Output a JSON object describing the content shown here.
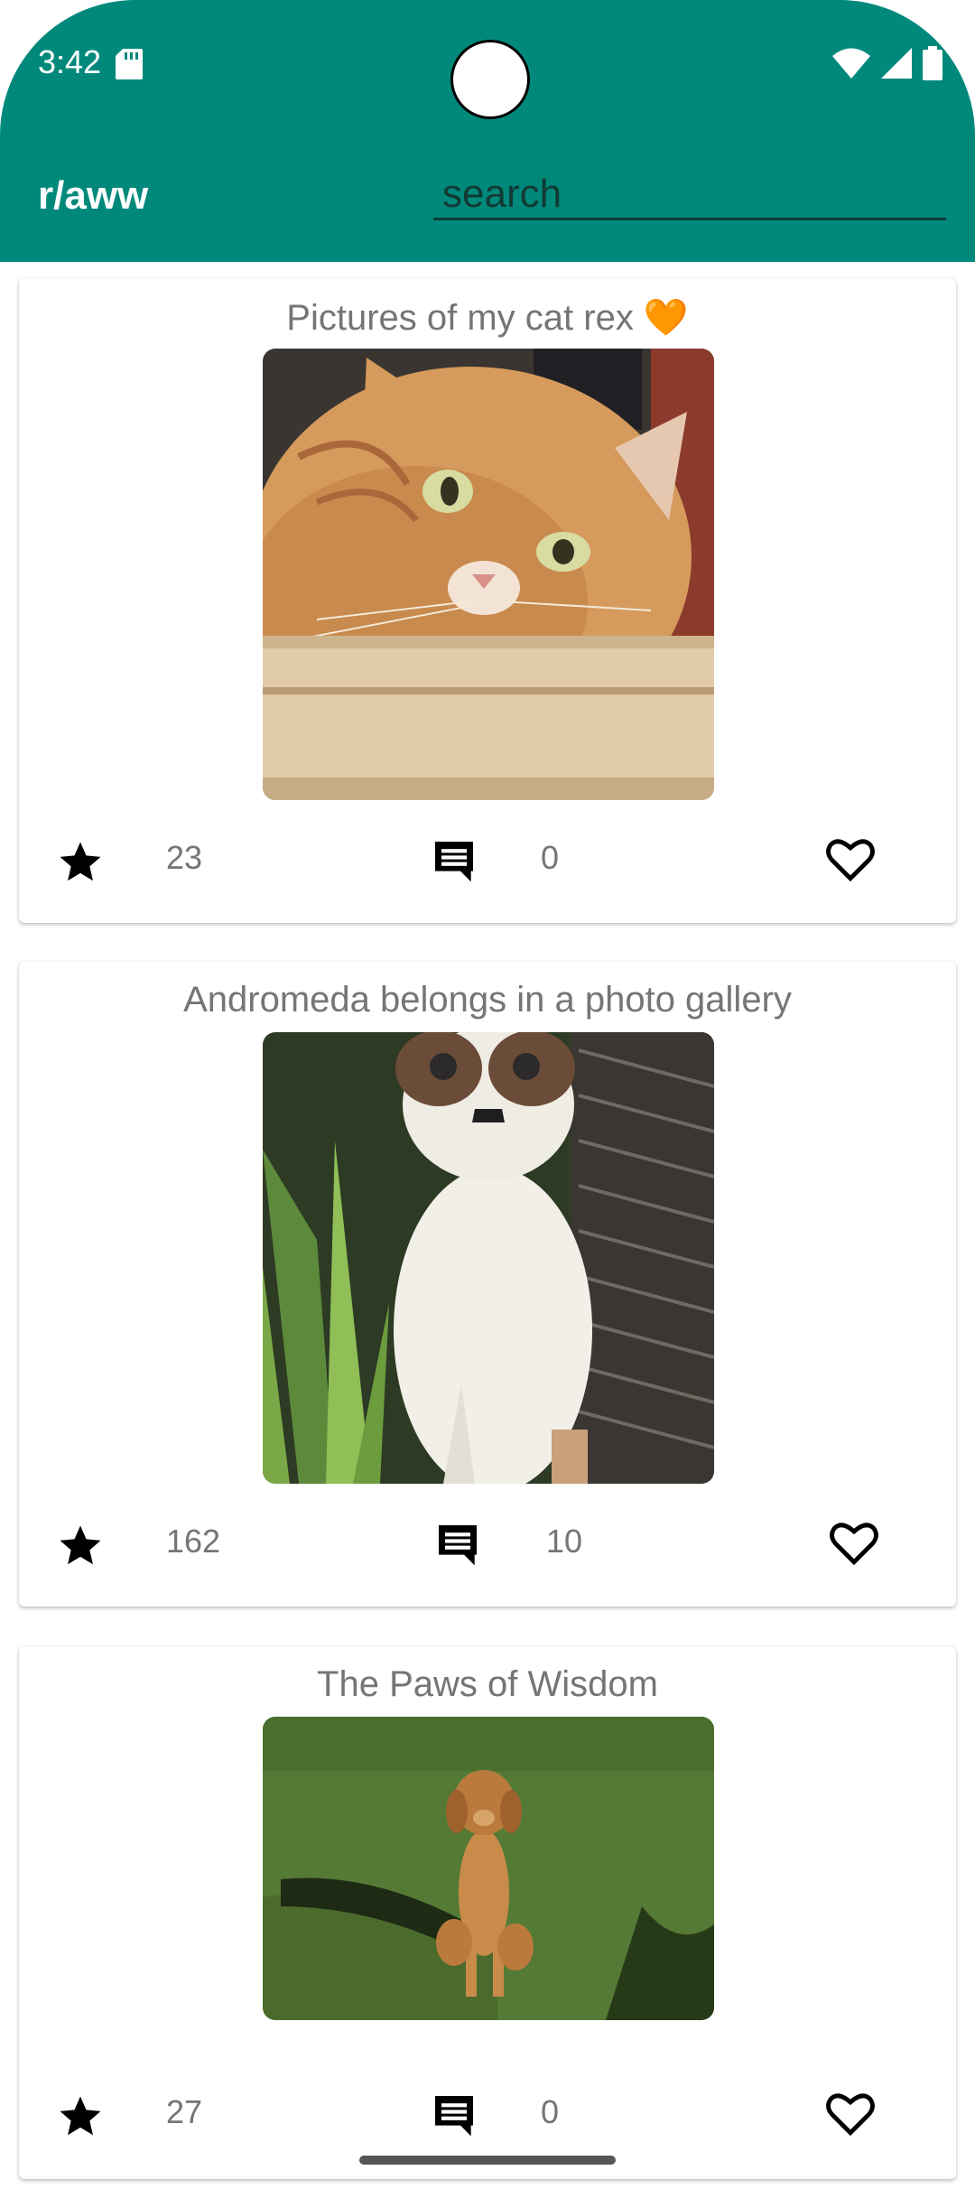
{
  "status_bar": {
    "time": "3:42"
  },
  "app_bar": {
    "title": "r/aww",
    "search_placeholder": "search"
  },
  "posts": [
    {
      "title": "Pictures of my cat rex 🧡",
      "stars": "23",
      "comments": "0"
    },
    {
      "title": "Andromeda belongs in a photo gallery",
      "stars": "162",
      "comments": "10"
    },
    {
      "title": "The Paws of Wisdom",
      "stars": "27",
      "comments": "0"
    }
  ],
  "colors": {
    "app_bar": "#00897B",
    "muted_text": "#757575"
  }
}
